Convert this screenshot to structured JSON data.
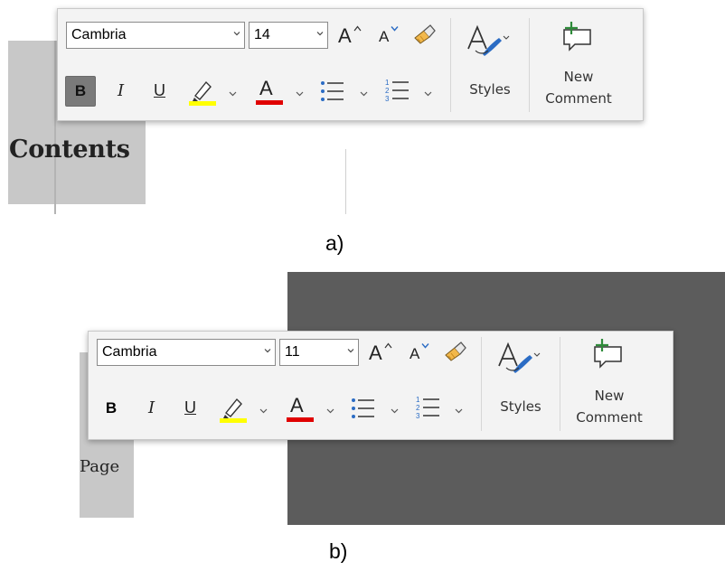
{
  "panel_a": {
    "caption": "a)",
    "document_text": "Contents",
    "toolbar": {
      "font_name": "Cambria",
      "font_size": "14",
      "grow_font": "A",
      "shrink_font": "A",
      "bold": "B",
      "italic": "I",
      "underline": "U",
      "font_color": "A",
      "styles_label": "Styles",
      "new_comment_line1": "New",
      "new_comment_line2": "Comment",
      "bold_active": true
    }
  },
  "panel_b": {
    "caption": "b)",
    "document_text": "Page",
    "toolbar": {
      "font_name": "Cambria",
      "font_size": "11",
      "grow_font": "A",
      "shrink_font": "A",
      "bold": "B",
      "italic": "I",
      "underline": "U",
      "font_color": "A",
      "styles_label": "Styles",
      "new_comment_line1": "New",
      "new_comment_line2": "Comment",
      "bold_active": false
    }
  },
  "colors": {
    "highlight": "#ffff00",
    "font_color_bar": "#e00000",
    "accent_blue": "#2b6cc4",
    "comment_plus": "#2e8b3a"
  },
  "icons": [
    "chevron-down-icon",
    "grow-font-icon",
    "shrink-font-icon",
    "format-painter-icon",
    "highlighter-icon",
    "bullets-icon",
    "numbering-icon",
    "styles-icon",
    "new-comment-icon"
  ]
}
